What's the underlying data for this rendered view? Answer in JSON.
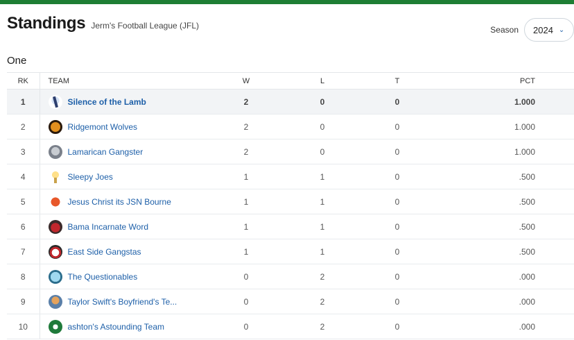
{
  "header": {
    "title": "Standings",
    "league": "Jerm's Football League (JFL)"
  },
  "season": {
    "label": "Season",
    "value": "2024"
  },
  "division": "One",
  "columns": {
    "rk": "RK",
    "team": "TEAM",
    "w": "W",
    "l": "L",
    "t": "T",
    "pct": "PCT"
  },
  "rows": [
    {
      "rk": "1",
      "team": "Silence of the Lamb",
      "w": "2",
      "l": "0",
      "t": "0",
      "pct": "1.000",
      "logo": "lamb-icon"
    },
    {
      "rk": "2",
      "team": "Ridgemont Wolves",
      "w": "2",
      "l": "0",
      "t": "0",
      "pct": "1.000",
      "logo": "wolf-icon"
    },
    {
      "rk": "3",
      "team": "Lamarican Gangster",
      "w": "2",
      "l": "0",
      "t": "0",
      "pct": "1.000",
      "logo": "gangster-icon"
    },
    {
      "rk": "4",
      "team": "Sleepy Joes",
      "w": "1",
      "l": "1",
      "t": "0",
      "pct": ".500",
      "logo": "ice-cream-icon"
    },
    {
      "rk": "5",
      "team": "Jesus Christ its JSN Bourne",
      "w": "1",
      "l": "1",
      "t": "0",
      "pct": ".500",
      "logo": "hot-dog-icon"
    },
    {
      "rk": "6",
      "team": "Bama Incarnate Word",
      "w": "1",
      "l": "1",
      "t": "0",
      "pct": ".500",
      "logo": "cardinal-icon"
    },
    {
      "rk": "7",
      "team": "East Side Gangstas",
      "w": "1",
      "l": "1",
      "t": "0",
      "pct": ".500",
      "logo": "clown-icon"
    },
    {
      "rk": "8",
      "team": "The Questionables",
      "w": "0",
      "l": "2",
      "t": "0",
      "pct": ".000",
      "logo": "helmet-icon"
    },
    {
      "rk": "9",
      "team": "Taylor Swift's Boyfriend's Te...",
      "w": "0",
      "l": "2",
      "t": "0",
      "pct": ".000",
      "logo": "player-icon"
    },
    {
      "rk": "10",
      "team": "ashton's Astounding Team",
      "w": "0",
      "l": "2",
      "t": "0",
      "pct": ".000",
      "logo": "green-helmet-icon"
    }
  ],
  "colors": {
    "accent": "#1e7e34",
    "link": "#1d5fa8",
    "highlight_row": "#f2f4f6"
  }
}
